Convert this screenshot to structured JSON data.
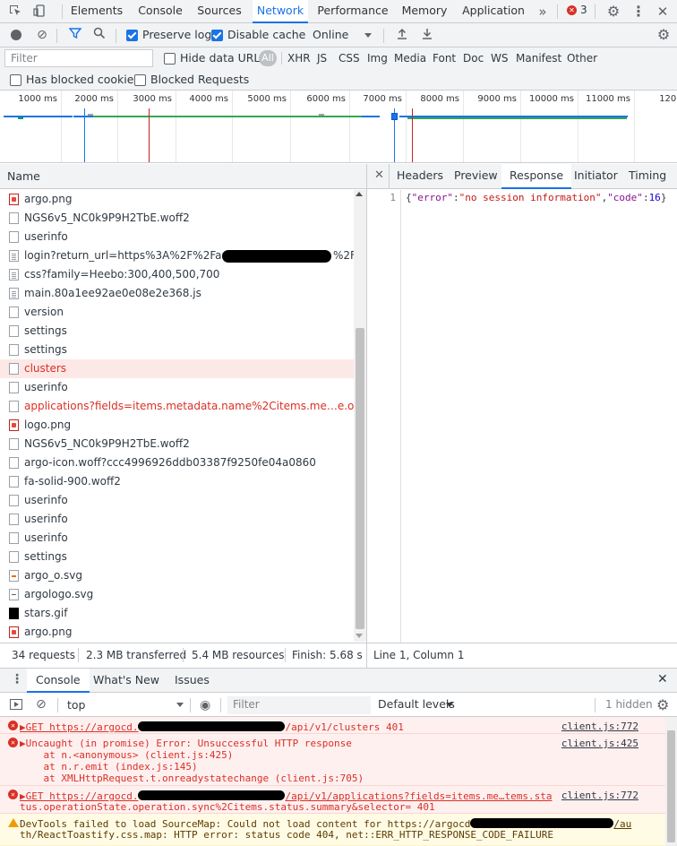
{
  "top_tabs": [
    "Elements",
    "Console",
    "Sources",
    "Network",
    "Performance",
    "Memory",
    "Application"
  ],
  "active_tab": "Network",
  "error_count": "3",
  "toolbar": {
    "preserve_log": "Preserve log",
    "disable_cache": "Disable cache",
    "throttle": "Online"
  },
  "filter": {
    "placeholder": "Filter",
    "hide_data_urls": "Hide data URLs",
    "types": [
      "All",
      "XHR",
      "JS",
      "CSS",
      "Img",
      "Media",
      "Font",
      "Doc",
      "WS",
      "Manifest",
      "Other"
    ],
    "has_blocked_cookies": "Has blocked cookies",
    "blocked_requests": "Blocked Requests"
  },
  "overview_ticks": [
    "1000 ms",
    "2000 ms",
    "3000 ms",
    "4000 ms",
    "5000 ms",
    "6000 ms",
    "7000 ms",
    "8000 ms",
    "9000 ms",
    "10000 ms",
    "11000 ms",
    "12000"
  ],
  "list_header": "Name",
  "requests": [
    {
      "name": "argo.png",
      "icon": "img"
    },
    {
      "name": "NGS6v5_NC0k9P9H2TbE.woff2",
      "icon": "file"
    },
    {
      "name": "userinfo",
      "icon": "file"
    },
    {
      "name": "login?return_url=https%3A%2F%2Fargocd.",
      "tail": "%2F",
      "icon": "doc"
    },
    {
      "name": "css?family=Heebo:300,400,500,700",
      "icon": "doc"
    },
    {
      "name": "main.80a1ee92ae0e08e2e368.js",
      "icon": "doc"
    },
    {
      "name": "version",
      "icon": "file"
    },
    {
      "name": "settings",
      "icon": "file"
    },
    {
      "name": "settings",
      "icon": "file"
    },
    {
      "name": "clusters",
      "icon": "file",
      "error": true
    },
    {
      "name": "userinfo",
      "icon": "file"
    },
    {
      "name": "applications?fields=items.metadata.name%2Citems.me…e.operation",
      "icon": "file",
      "error": true
    },
    {
      "name": "logo.png",
      "icon": "img"
    },
    {
      "name": "NGS6v5_NC0k9P9H2TbE.woff2",
      "icon": "file"
    },
    {
      "name": "argo-icon.woff?ccc4996926ddb03387f9250fe04a0860",
      "icon": "file"
    },
    {
      "name": "fa-solid-900.woff2",
      "icon": "file"
    },
    {
      "name": "userinfo",
      "icon": "file"
    },
    {
      "name": "userinfo",
      "icon": "file"
    },
    {
      "name": "userinfo",
      "icon": "file"
    },
    {
      "name": "settings",
      "icon": "file"
    },
    {
      "name": "argo_o.svg",
      "icon": "svg"
    },
    {
      "name": "argologo.svg",
      "icon": "svg2"
    },
    {
      "name": "stars.gif",
      "icon": "gif"
    },
    {
      "name": "argo.png",
      "icon": "img"
    }
  ],
  "status": {
    "requests": "34 requests",
    "transferred": "2.3 MB transferred",
    "resources": "5.4 MB resources",
    "finish": "Finish: 5.68 s"
  },
  "detail_tabs": [
    "Headers",
    "Preview",
    "Response",
    "Initiator",
    "Timing"
  ],
  "active_detail_tab": "Response",
  "response": {
    "line_no": "1",
    "p1": "{",
    "k1": "\"error\"",
    "c1": ":",
    "v1": "\"no session information\"",
    "c2": ",",
    "k2": "\"code\"",
    "c3": ":",
    "v2": "16",
    "p2": "}"
  },
  "cursor_position": "Line 1, Column 1",
  "drawer_tabs": [
    "Console",
    "What's New",
    "Issues"
  ],
  "console_toolbar": {
    "context": "top",
    "filter_placeholder": "Filter",
    "levels": "Default levels",
    "hidden": "1 hidden"
  },
  "messages": [
    {
      "lines": [
        "▶GET https://argocd.",
        "/api/v1/clusters 401"
      ],
      "source": "client.js:772"
    },
    {
      "lines": [
        "▶Uncaught (in promise) Error: Unsuccessful HTTP response",
        "    at n.<anonymous> (client.js:425)",
        "    at n.r.emit (index.js:145)",
        "    at XMLHttpRequest.t.onreadystatechange (client.js:705)"
      ],
      "source": "client.js:425"
    },
    {
      "lines": [
        "▶GET https://argocd.",
        "/api/v1/applications?fields=items.me…tems.sta",
        "tus.operationState.operation.sync%2Citems.status.summary&selector= 401"
      ],
      "source": "client.js:772"
    },
    {
      "lines": [
        "DevTools failed to load SourceMap: Could not load content for https://argocd",
        "/au",
        "th/ReactToastify.css.map: HTTP error: status code 404, net::ERR_HTTP_RESPONSE_CODE_FAILURE"
      ]
    }
  ]
}
